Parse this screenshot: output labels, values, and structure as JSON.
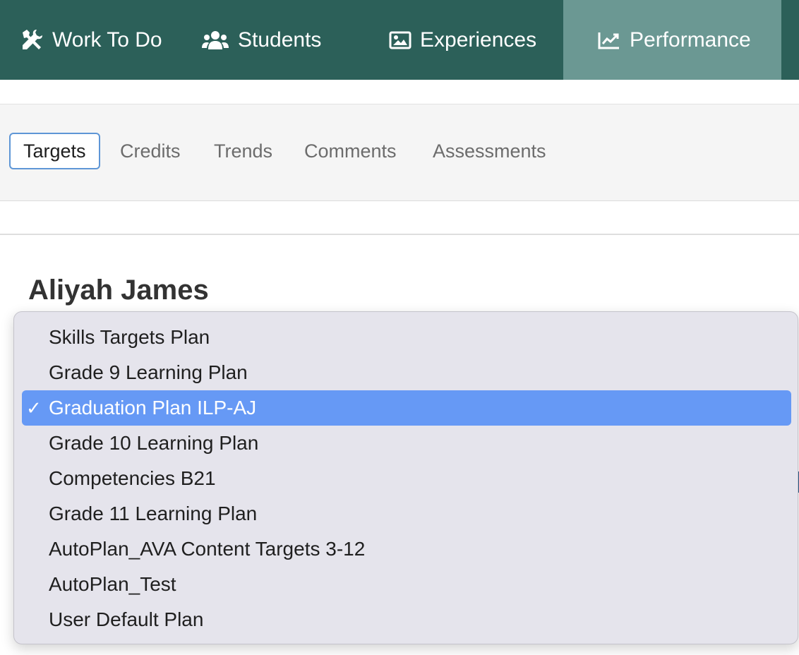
{
  "topnav": {
    "items": [
      {
        "label": "Work To Do",
        "icon": "tools-icon"
      },
      {
        "label": "Students",
        "icon": "users-icon"
      },
      {
        "label": "Experiences",
        "icon": "image-icon"
      },
      {
        "label": "Performance",
        "icon": "line-chart-icon",
        "active": true
      }
    ]
  },
  "subtabs": {
    "items": [
      {
        "label": "Targets",
        "active": true
      },
      {
        "label": "Credits"
      },
      {
        "label": "Trends"
      },
      {
        "label": "Comments"
      },
      {
        "label": "Assessments"
      }
    ]
  },
  "student": {
    "name": "Aliyah James"
  },
  "plan_dropdown": {
    "check_glyph": "✓",
    "selected": "Graduation Plan ILP-AJ",
    "options": [
      "Skills Targets Plan",
      "Grade 9 Learning Plan",
      "Graduation Plan ILP-AJ",
      "Grade 10 Learning Plan",
      "Competencies B21",
      "Grade 11 Learning Plan",
      "AutoPlan_AVA Content Targets 3-12",
      "AutoPlan_Test",
      "User Default Plan"
    ]
  },
  "colors": {
    "nav_bg": "#2c6059",
    "nav_active_bg": "#6b9893",
    "tab_active_border": "#5e96d6",
    "dropdown_bg": "#e5e4ec",
    "selected_option_bg": "#6699f5"
  }
}
